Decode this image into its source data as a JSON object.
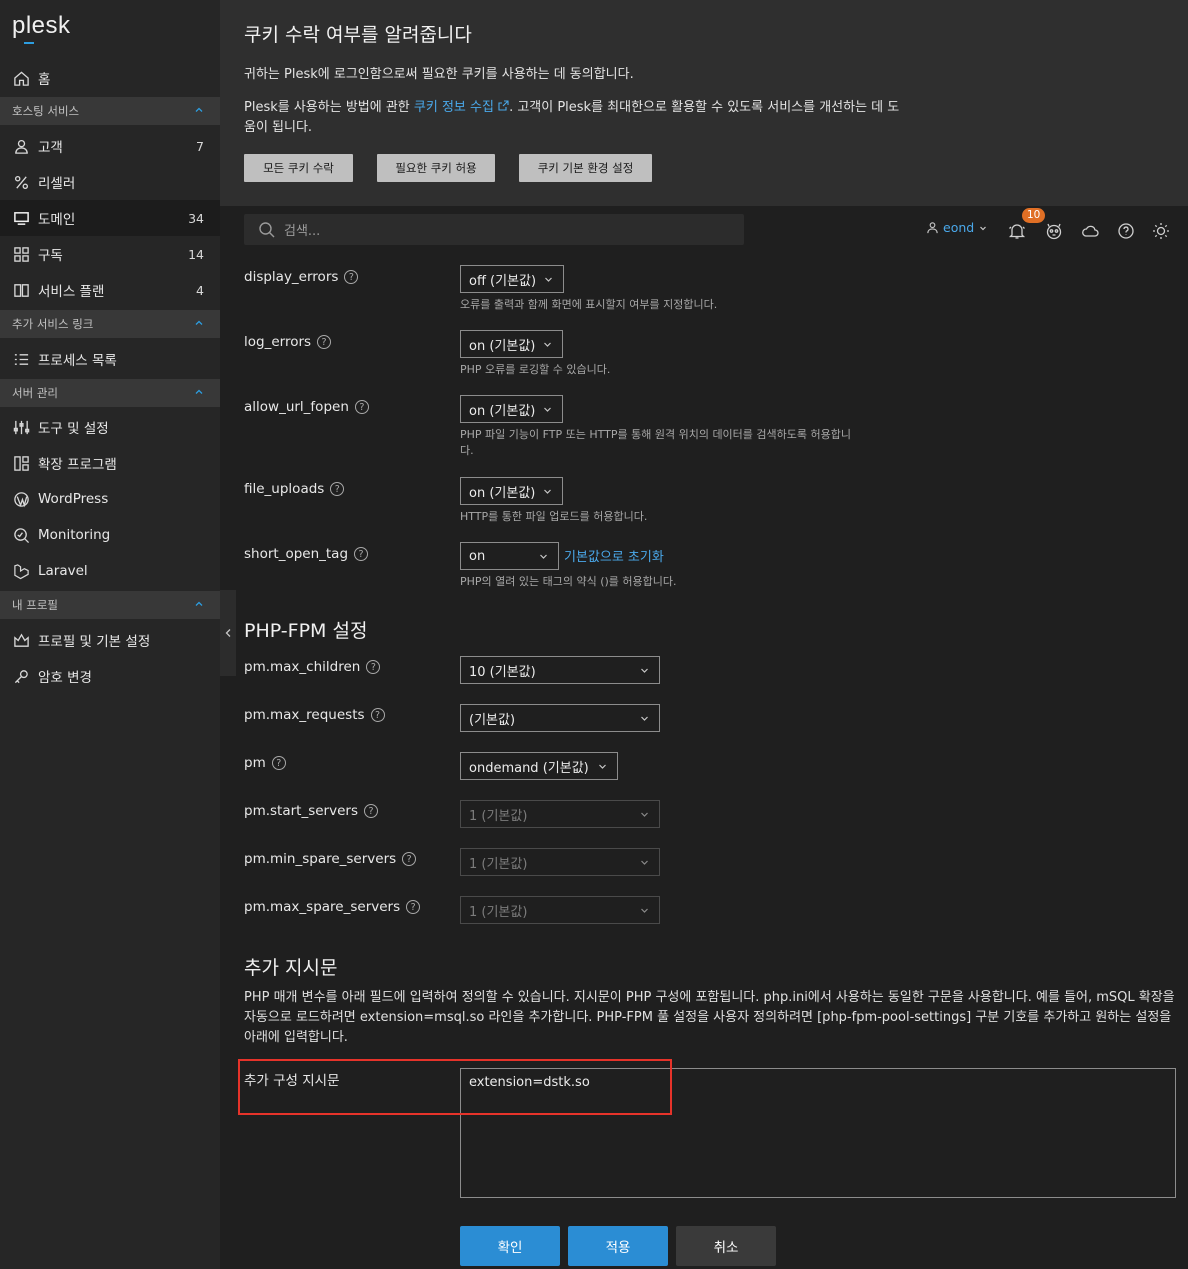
{
  "app": {
    "logo": "plesk"
  },
  "sidebar": {
    "home": {
      "label": "홈",
      "icon": "home-icon"
    },
    "sections": [
      {
        "label": "호스팅 서비스"
      },
      {
        "label": "추가 서비스 링크"
      },
      {
        "label": "서버 관리"
      },
      {
        "label": "내 프로필"
      }
    ],
    "items": [
      {
        "label": "고객",
        "count": "7",
        "icon": "user-icon"
      },
      {
        "label": "리셀러",
        "count": "",
        "icon": "percent-icon"
      },
      {
        "label": "도메인",
        "count": "34",
        "icon": "monitor-icon"
      },
      {
        "label": "구독",
        "count": "14",
        "icon": "grid-icon"
      },
      {
        "label": "서비스 플랜",
        "count": "4",
        "icon": "book-icon"
      },
      {
        "label": "프로세스 목록",
        "count": "",
        "icon": "list-icon"
      },
      {
        "label": "도구 및 설정",
        "count": "",
        "icon": "sliders-icon"
      },
      {
        "label": "확장 프로그램",
        "count": "",
        "icon": "extensions-icon"
      },
      {
        "label": "WordPress",
        "count": "",
        "icon": "wordpress-icon"
      },
      {
        "label": "Monitoring",
        "count": "",
        "icon": "monitoring-icon"
      },
      {
        "label": "Laravel",
        "count": "",
        "icon": "laravel-icon"
      },
      {
        "label": "프로필 및 기본 설정",
        "count": "",
        "icon": "profile-icon"
      },
      {
        "label": "암호 변경",
        "count": "",
        "icon": "key-icon"
      }
    ]
  },
  "cookie": {
    "title": "쿠키 수락 여부를 알려줍니다",
    "p1": "귀하는 Plesk에 로그인함으로써 필요한 쿠키를 사용하는 데 동의합니다.",
    "p2_before": "Plesk를 사용하는 방법에 관한 ",
    "p2_link": "쿠키 정보 수집",
    "p2_after": ". 고객이 Plesk를 최대한으로 활용할 수 있도록 서비스를 개선하는 데 도움이 됩니다.",
    "btn_accept_all": "모든 쿠키 수락",
    "btn_required": "필요한 쿠키 허용",
    "btn_prefs": "쿠키 기본 환경 설정"
  },
  "header": {
    "search_placeholder": "검색...",
    "user": "eond",
    "notifications": "10"
  },
  "php": {
    "display_errors": {
      "label": "display_errors",
      "value": "off (기본값)",
      "hint": "오류를 출력과 함께 화면에 표시할지 여부를 지정합니다."
    },
    "log_errors": {
      "label": "log_errors",
      "value": "on (기본값)",
      "hint": "PHP 오류를 로깅할 수 있습니다."
    },
    "allow_url_fopen": {
      "label": "allow_url_fopen",
      "value": "on (기본값)",
      "hint": "PHP 파일 기능이 FTP 또는 HTTP를 통해 원격 위치의 데이터를 검색하도록 허용합니다."
    },
    "file_uploads": {
      "label": "file_uploads",
      "value": "on (기본값)",
      "hint": "HTTP를 통한 파일 업로드를 허용합니다."
    },
    "short_open_tag": {
      "label": "short_open_tag",
      "value": "on",
      "link": "기본값으로 초기화",
      "hint": "PHP의 열려 있는 태그의 약식 ()를 허용합니다."
    }
  },
  "fpm": {
    "title": "PHP-FPM 설정",
    "max_children": {
      "label": "pm.max_children",
      "value": "10 (기본값)"
    },
    "max_requests": {
      "label": "pm.max_requests",
      "value": " (기본값)"
    },
    "pm": {
      "label": "pm",
      "value": "ondemand (기본값)"
    },
    "start_servers": {
      "label": "pm.start_servers",
      "value": "1 (기본값)"
    },
    "min_spare": {
      "label": "pm.min_spare_servers",
      "value": "1 (기본값)"
    },
    "max_spare": {
      "label": "pm.max_spare_servers",
      "value": "1 (기본값)"
    }
  },
  "extra": {
    "title": "추가 지시문",
    "desc": "PHP 매개 변수를 아래 필드에 입력하여 정의할 수 있습니다. 지시문이 PHP 구성에 포함됩니다. php.ini에서 사용하는 동일한 구문을 사용합니다. 예를 들어, mSQL 확장을 자동으로 로드하려면 extension=msql.so 라인을 추가합니다. PHP-FPM 풀 설정을 사용자 정의하려면 [php-fpm-pool-settings] 구분 기호를 추가하고 원하는 설정을 아래에 입력합니다.",
    "label": "추가 구성 지시문",
    "value": "extension=dstk.so"
  },
  "buttons": {
    "ok": "확인",
    "apply": "적용",
    "cancel": "취소"
  },
  "colors": {
    "accent": "#2b8dd4",
    "link": "#4aa8ea",
    "badge": "#e06f25",
    "highlight": "#e6332a"
  }
}
